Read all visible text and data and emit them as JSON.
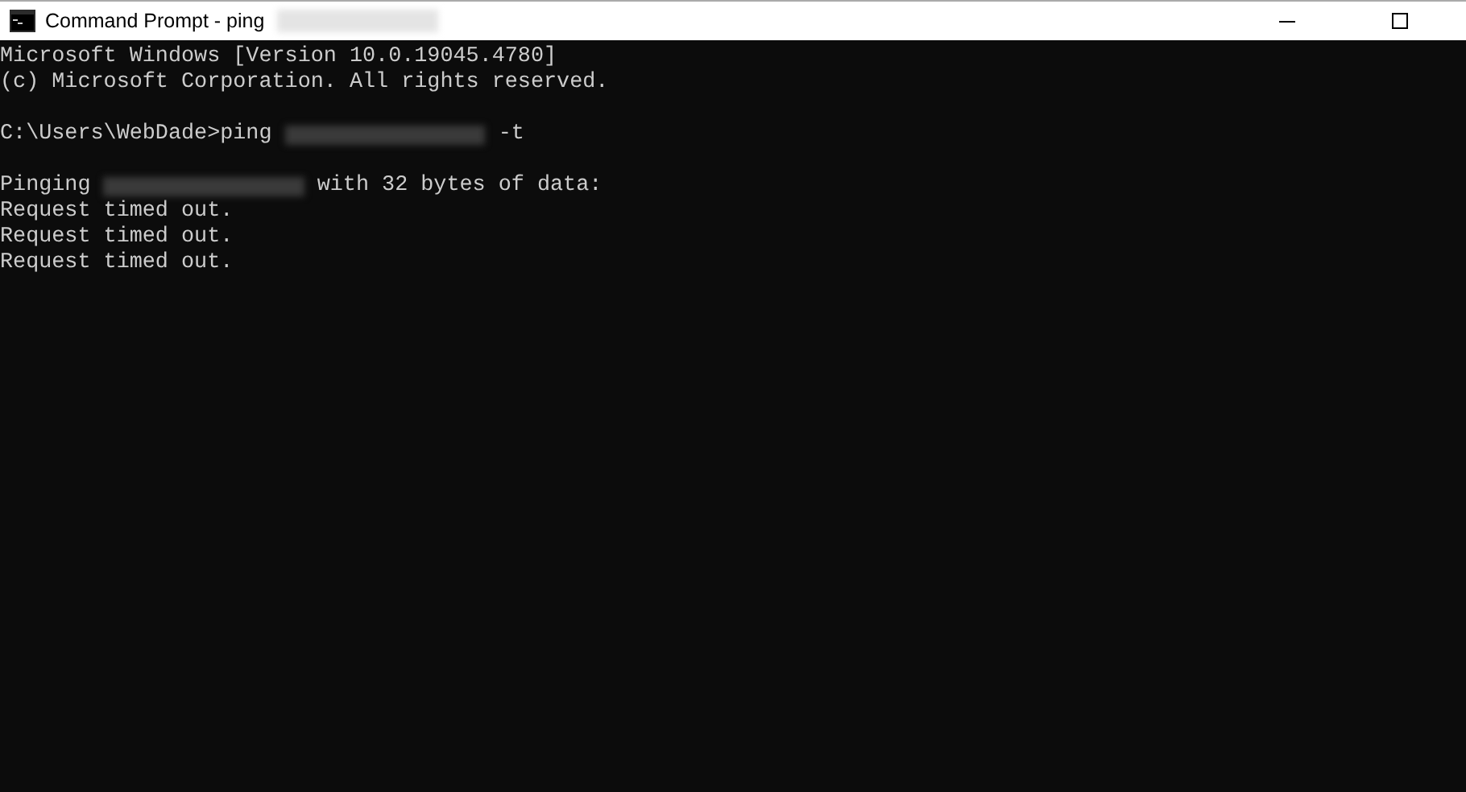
{
  "window": {
    "title": [
      {
        "kind": "text",
        "text": "Command Prompt - ping"
      },
      {
        "kind": "redacted"
      }
    ]
  },
  "console": {
    "lines": [
      {
        "kind": "text",
        "segments": [
          {
            "kind": "text",
            "text": "Microsoft Windows [Version 10.0.19045.4780]"
          }
        ]
      },
      {
        "kind": "text",
        "segments": [
          {
            "kind": "text",
            "text": "(c) Microsoft Corporation. All rights reserved."
          }
        ]
      },
      {
        "kind": "blank"
      },
      {
        "kind": "text",
        "segments": [
          {
            "kind": "text",
            "text": "C:\\Users\\WebDade>ping"
          },
          {
            "kind": "redacted"
          },
          {
            "kind": "text",
            "text": "-t"
          }
        ]
      },
      {
        "kind": "blank"
      },
      {
        "kind": "text",
        "segments": [
          {
            "kind": "text",
            "text": "Pinging"
          },
          {
            "kind": "redacted"
          },
          {
            "kind": "text",
            "text": "with 32 bytes of data:"
          }
        ]
      },
      {
        "kind": "text",
        "segments": [
          {
            "kind": "text",
            "text": "Request timed out."
          }
        ]
      },
      {
        "kind": "text",
        "segments": [
          {
            "kind": "text",
            "text": "Request timed out."
          }
        ]
      },
      {
        "kind": "text",
        "segments": [
          {
            "kind": "text",
            "text": "Request timed out."
          }
        ]
      }
    ]
  }
}
